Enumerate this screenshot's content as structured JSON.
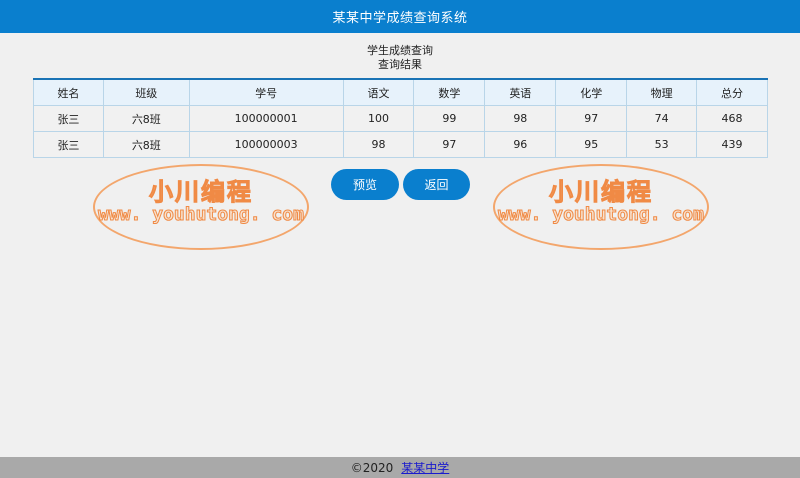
{
  "header": {
    "title": "某某中学成绩查询系统"
  },
  "heading": {
    "line1": "学生成绩查询",
    "line2": "查询结果"
  },
  "table": {
    "columns": [
      "姓名",
      "班级",
      "学号",
      "语文",
      "数学",
      "英语",
      "化学",
      "物理",
      "总分"
    ],
    "rows": [
      [
        "张三",
        "六8班",
        "100000001",
        "100",
        "99",
        "98",
        "97",
        "74",
        "468"
      ],
      [
        "张三",
        "六8班",
        "100000003",
        "98",
        "97",
        "96",
        "95",
        "53",
        "439"
      ]
    ]
  },
  "buttons": {
    "preview": "预览",
    "back": "返回"
  },
  "watermark": {
    "text": "小川编程",
    "url": "www. youhutong. com"
  },
  "footer": {
    "copyright": "©2020",
    "link": "某某中学"
  },
  "colors": {
    "accent": "#0a7fce",
    "footer_bg": "#a9a9a9"
  }
}
